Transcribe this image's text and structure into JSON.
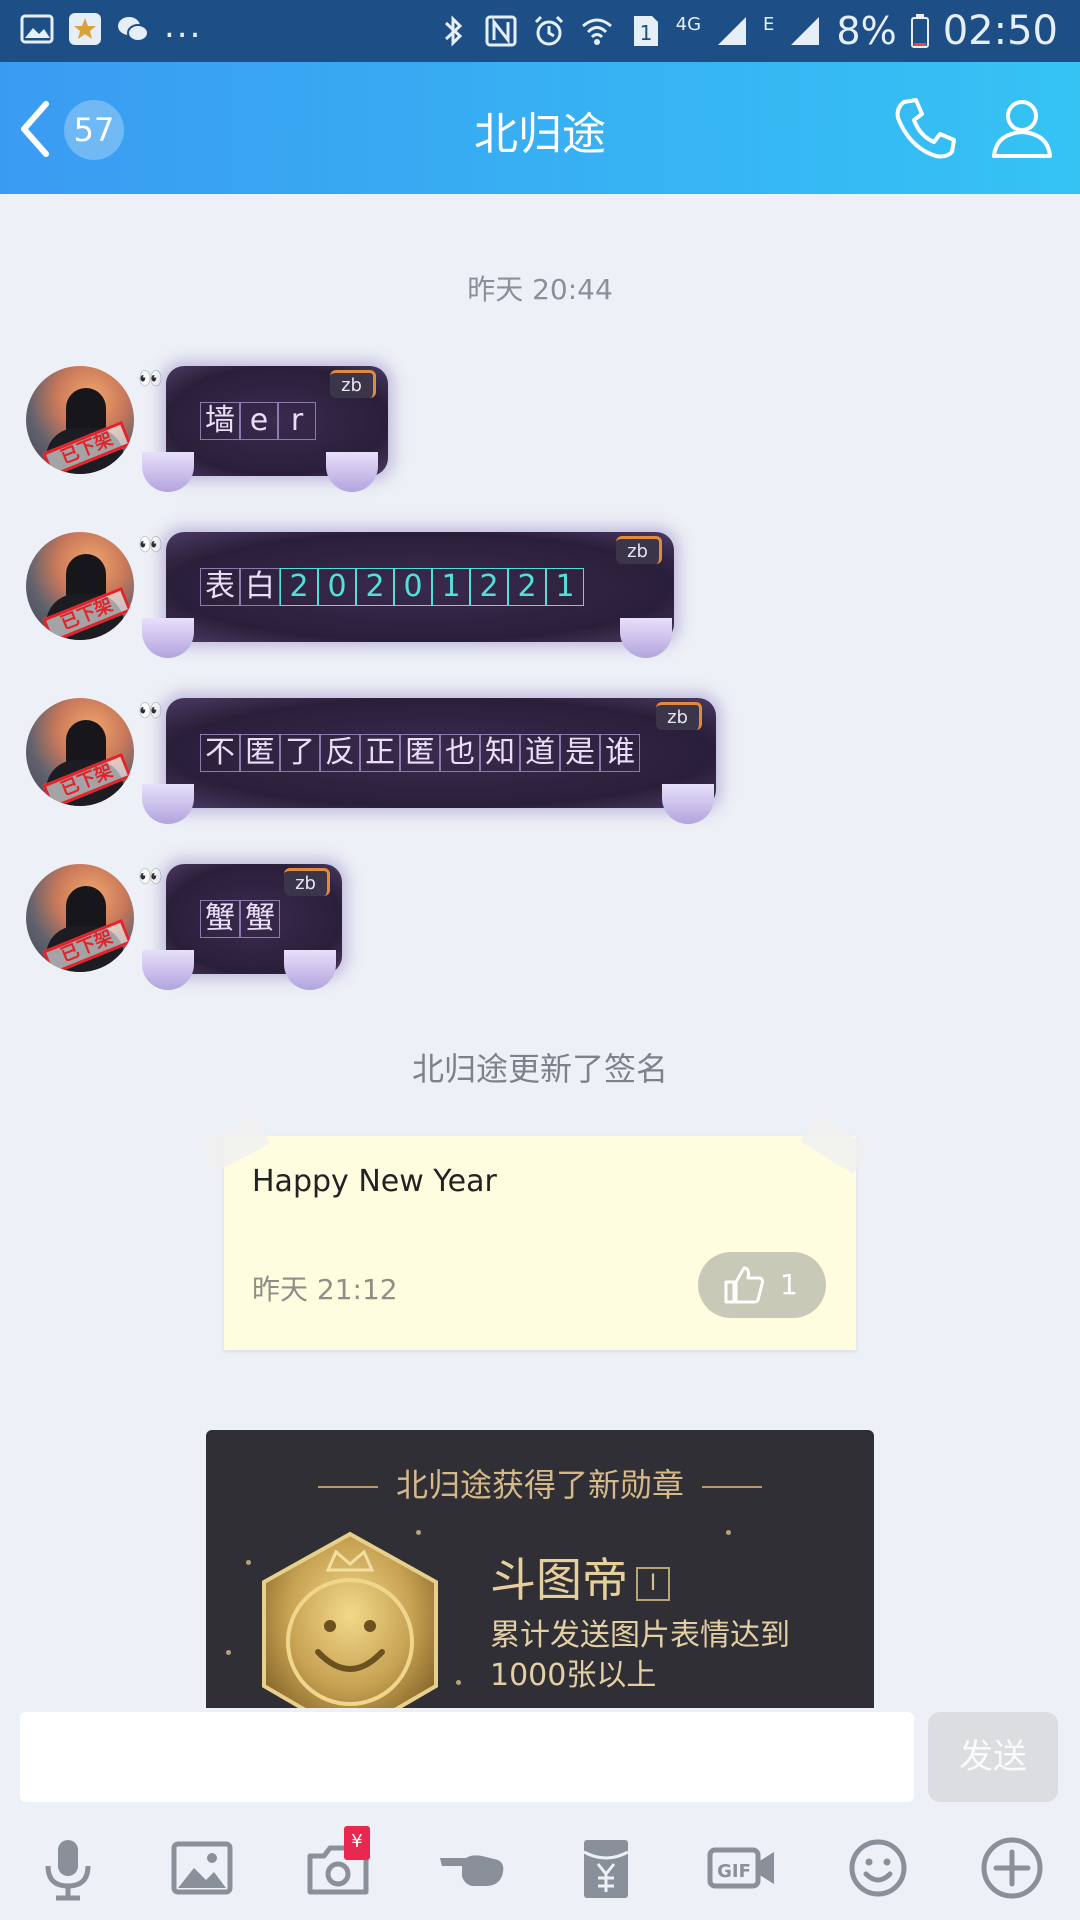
{
  "status_bar": {
    "left_icons": [
      "gallery-icon",
      "star-app-icon",
      "wechat-icon"
    ],
    "more": "...",
    "right_icons": [
      "bluetooth-icon",
      "nfc-icon",
      "alarm-icon",
      "wifi-icon",
      "sim-icon",
      "signal-icon"
    ],
    "network_4g": "4G",
    "network_e": "E",
    "battery": "8%",
    "time": "02:50"
  },
  "header": {
    "title": "北归途",
    "unread_count": "57",
    "actions": [
      "phone-icon",
      "profile-icon"
    ]
  },
  "chat": {
    "timestamp": "昨天 20:44",
    "messages": [
      {
        "badge": "zb",
        "chars": [
          "墙",
          "e",
          "r"
        ],
        "stamp": "已下架"
      },
      {
        "badge": "zb",
        "chars": [
          "表",
          "白"
        ],
        "digits": [
          "2",
          "0",
          "2",
          "0",
          "1",
          "2",
          "2",
          "1"
        ],
        "stamp": "已下架"
      },
      {
        "badge": "zb",
        "chars": [
          "不",
          "匿",
          "了",
          "反",
          "正",
          "匿",
          "也",
          "知",
          "道",
          "是",
          "谁"
        ],
        "stamp": "已下架"
      },
      {
        "badge": "zb",
        "chars": [
          "蟹",
          "蟹"
        ],
        "stamp": "已下架"
      }
    ],
    "signature_update": "北归途更新了签名",
    "signature_card": {
      "text": "Happy New Year",
      "time": "昨天 21:12",
      "likes": "1"
    },
    "medal_card": {
      "header": "北归途获得了新勋章",
      "name": "斗图帝",
      "level": "I",
      "description": "累计发送图片表情达到1000张以上"
    }
  },
  "input": {
    "placeholder": "",
    "send_label": "发送"
  },
  "toolbar": {
    "items": [
      "microphone-icon",
      "image-icon",
      "camera-icon",
      "poke-icon",
      "red-packet-icon",
      "gif-icon",
      "emoji-icon",
      "plus-icon"
    ],
    "camera_badge": "¥"
  },
  "colors": {
    "header_gradient_start": "#3a9bf2",
    "header_gradient_end": "#35c3f4",
    "status_bar": "#1d4f86",
    "background": "#edf0f6",
    "note_bg": "#fffde0",
    "medal_bg": "#2f2f35"
  }
}
